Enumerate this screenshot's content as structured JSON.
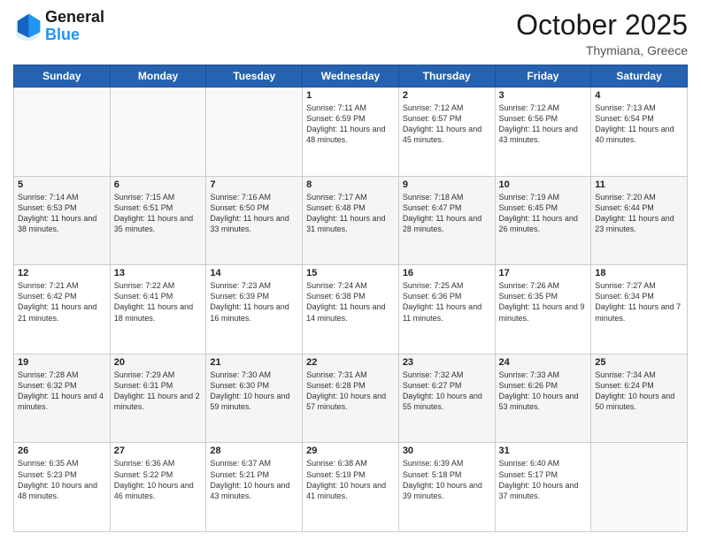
{
  "header": {
    "logo_general": "General",
    "logo_blue": "Blue",
    "month_title": "October 2025",
    "subtitle": "Thymiana, Greece"
  },
  "days_of_week": [
    "Sunday",
    "Monday",
    "Tuesday",
    "Wednesday",
    "Thursday",
    "Friday",
    "Saturday"
  ],
  "weeks": [
    [
      {
        "day": "",
        "info": ""
      },
      {
        "day": "",
        "info": ""
      },
      {
        "day": "",
        "info": ""
      },
      {
        "day": "1",
        "info": "Sunrise: 7:11 AM\nSunset: 6:59 PM\nDaylight: 11 hours and 48 minutes."
      },
      {
        "day": "2",
        "info": "Sunrise: 7:12 AM\nSunset: 6:57 PM\nDaylight: 11 hours and 45 minutes."
      },
      {
        "day": "3",
        "info": "Sunrise: 7:12 AM\nSunset: 6:56 PM\nDaylight: 11 hours and 43 minutes."
      },
      {
        "day": "4",
        "info": "Sunrise: 7:13 AM\nSunset: 6:54 PM\nDaylight: 11 hours and 40 minutes."
      }
    ],
    [
      {
        "day": "5",
        "info": "Sunrise: 7:14 AM\nSunset: 6:53 PM\nDaylight: 11 hours and 38 minutes."
      },
      {
        "day": "6",
        "info": "Sunrise: 7:15 AM\nSunset: 6:51 PM\nDaylight: 11 hours and 35 minutes."
      },
      {
        "day": "7",
        "info": "Sunrise: 7:16 AM\nSunset: 6:50 PM\nDaylight: 11 hours and 33 minutes."
      },
      {
        "day": "8",
        "info": "Sunrise: 7:17 AM\nSunset: 6:48 PM\nDaylight: 11 hours and 31 minutes."
      },
      {
        "day": "9",
        "info": "Sunrise: 7:18 AM\nSunset: 6:47 PM\nDaylight: 11 hours and 28 minutes."
      },
      {
        "day": "10",
        "info": "Sunrise: 7:19 AM\nSunset: 6:45 PM\nDaylight: 11 hours and 26 minutes."
      },
      {
        "day": "11",
        "info": "Sunrise: 7:20 AM\nSunset: 6:44 PM\nDaylight: 11 hours and 23 minutes."
      }
    ],
    [
      {
        "day": "12",
        "info": "Sunrise: 7:21 AM\nSunset: 6:42 PM\nDaylight: 11 hours and 21 minutes."
      },
      {
        "day": "13",
        "info": "Sunrise: 7:22 AM\nSunset: 6:41 PM\nDaylight: 11 hours and 18 minutes."
      },
      {
        "day": "14",
        "info": "Sunrise: 7:23 AM\nSunset: 6:39 PM\nDaylight: 11 hours and 16 minutes."
      },
      {
        "day": "15",
        "info": "Sunrise: 7:24 AM\nSunset: 6:38 PM\nDaylight: 11 hours and 14 minutes."
      },
      {
        "day": "16",
        "info": "Sunrise: 7:25 AM\nSunset: 6:36 PM\nDaylight: 11 hours and 11 minutes."
      },
      {
        "day": "17",
        "info": "Sunrise: 7:26 AM\nSunset: 6:35 PM\nDaylight: 11 hours and 9 minutes."
      },
      {
        "day": "18",
        "info": "Sunrise: 7:27 AM\nSunset: 6:34 PM\nDaylight: 11 hours and 7 minutes."
      }
    ],
    [
      {
        "day": "19",
        "info": "Sunrise: 7:28 AM\nSunset: 6:32 PM\nDaylight: 11 hours and 4 minutes."
      },
      {
        "day": "20",
        "info": "Sunrise: 7:29 AM\nSunset: 6:31 PM\nDaylight: 11 hours and 2 minutes."
      },
      {
        "day": "21",
        "info": "Sunrise: 7:30 AM\nSunset: 6:30 PM\nDaylight: 10 hours and 59 minutes."
      },
      {
        "day": "22",
        "info": "Sunrise: 7:31 AM\nSunset: 6:28 PM\nDaylight: 10 hours and 57 minutes."
      },
      {
        "day": "23",
        "info": "Sunrise: 7:32 AM\nSunset: 6:27 PM\nDaylight: 10 hours and 55 minutes."
      },
      {
        "day": "24",
        "info": "Sunrise: 7:33 AM\nSunset: 6:26 PM\nDaylight: 10 hours and 53 minutes."
      },
      {
        "day": "25",
        "info": "Sunrise: 7:34 AM\nSunset: 6:24 PM\nDaylight: 10 hours and 50 minutes."
      }
    ],
    [
      {
        "day": "26",
        "info": "Sunrise: 6:35 AM\nSunset: 5:23 PM\nDaylight: 10 hours and 48 minutes."
      },
      {
        "day": "27",
        "info": "Sunrise: 6:36 AM\nSunset: 5:22 PM\nDaylight: 10 hours and 46 minutes."
      },
      {
        "day": "28",
        "info": "Sunrise: 6:37 AM\nSunset: 5:21 PM\nDaylight: 10 hours and 43 minutes."
      },
      {
        "day": "29",
        "info": "Sunrise: 6:38 AM\nSunset: 5:19 PM\nDaylight: 10 hours and 41 minutes."
      },
      {
        "day": "30",
        "info": "Sunrise: 6:39 AM\nSunset: 5:18 PM\nDaylight: 10 hours and 39 minutes."
      },
      {
        "day": "31",
        "info": "Sunrise: 6:40 AM\nSunset: 5:17 PM\nDaylight: 10 hours and 37 minutes."
      },
      {
        "day": "",
        "info": ""
      }
    ]
  ]
}
